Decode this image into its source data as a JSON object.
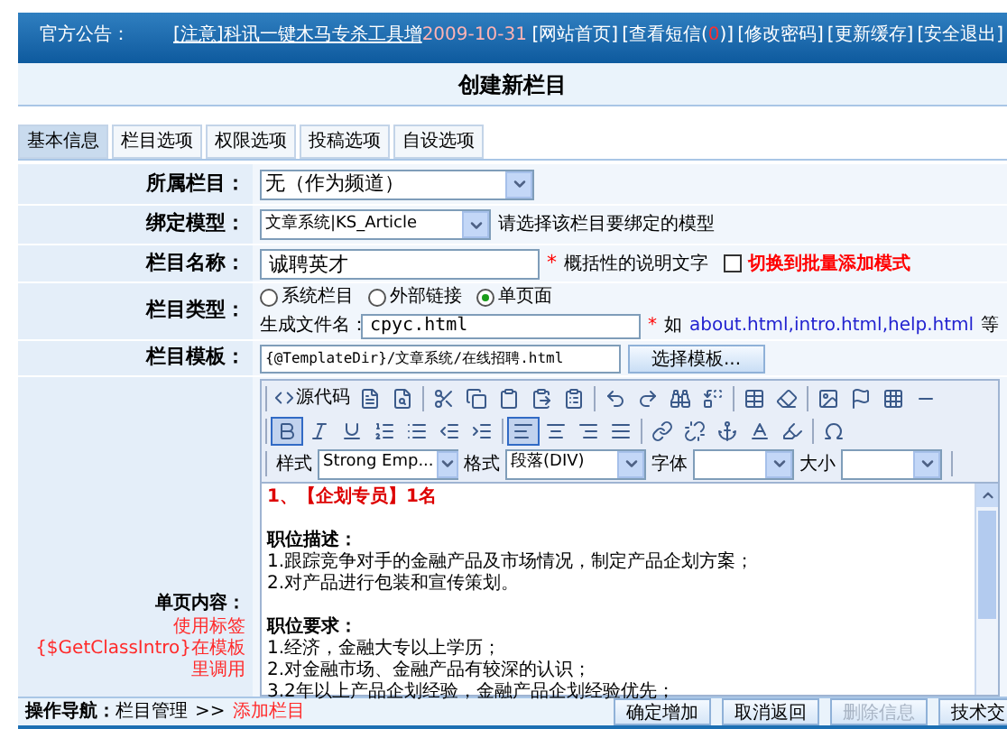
{
  "header": {
    "notice_label": "官方公告：",
    "notice_link": "[注意]科讯一键木马专杀工具增",
    "notice_date": "2009-10-31",
    "links": [
      {
        "text": "[网站首页]"
      },
      {
        "text": "[查看短信(",
        "count": "0",
        "after": ")]"
      },
      {
        "text": "[修改密码]"
      },
      {
        "text": "[更新缓存]"
      },
      {
        "text": "[安全退出]"
      }
    ]
  },
  "page_title": "创建新栏目",
  "tabs": [
    {
      "label": "基本信息",
      "selected": true
    },
    {
      "label": "栏目选项",
      "selected": false
    },
    {
      "label": "权限选项",
      "selected": false
    },
    {
      "label": "投稿选项",
      "selected": false
    },
    {
      "label": "自设选项",
      "selected": false
    }
  ],
  "form": {
    "parent": {
      "label": "所属栏目：",
      "value": "无（作为频道）"
    },
    "model": {
      "label": "绑定模型：",
      "value": "文章系统|KS_Article",
      "hint": "请选择该栏目要绑定的模型"
    },
    "name": {
      "label": "栏目名称：",
      "value": "诚聘英才",
      "required": "*",
      "hint": "概括性的说明文字",
      "batch_label": "切换到批量添加模式",
      "batch_checked": false
    },
    "type": {
      "label": "栏目类型：",
      "options": [
        {
          "label": "系统栏目",
          "selected": false
        },
        {
          "label": "外部链接",
          "selected": false
        },
        {
          "label": "单页面",
          "selected": true
        }
      ],
      "file_label": "生成文件名：",
      "file_value": "cpyc.html",
      "required": "*",
      "example_prefix": "如",
      "example_files": "about.html,intro.html,help.html",
      "example_suffix": "等"
    },
    "template": {
      "label": "栏目模板：",
      "value": "{@TemplateDir}/文章系统/在线招聘.html",
      "button": "选择模板..."
    },
    "content": {
      "label": "单页内容：",
      "note": "使用标签{$GetClassIntro}在模板里调用"
    }
  },
  "editor": {
    "source_label": "源代码",
    "dropdowns": [
      {
        "label": "样式",
        "value": "Strong Emp..."
      },
      {
        "label": "格式",
        "value": "段落(DIV)"
      },
      {
        "label": "字体"
      },
      {
        "label": "大小"
      }
    ],
    "bold_active": true,
    "align_left_active": true,
    "lines": [
      {
        "kind": "title",
        "text": "1、【企划专员】1名"
      },
      {
        "kind": "blank"
      },
      {
        "kind": "heading",
        "text": "职位描述："
      },
      {
        "kind": "text",
        "text": "1.跟踪竞争对手的金融产品及市场情况，制定产品企划方案；"
      },
      {
        "kind": "text",
        "text": "2.对产品进行包装和宣传策划。"
      },
      {
        "kind": "blank"
      },
      {
        "kind": "heading",
        "text": "职位要求："
      },
      {
        "kind": "text",
        "text": "1.经济，金融大专以上学历；"
      },
      {
        "kind": "text",
        "text": "2.对金融市场、金融产品有较深的认识；"
      },
      {
        "kind": "text",
        "text": "3.2年以上产品企划经验，金融产品企划经验优先；"
      }
    ]
  },
  "footer": {
    "nav_label": "操作导航：",
    "crumb": "栏目管理",
    "sep": ">>",
    "current": "添加栏目",
    "buttons": [
      {
        "label": "确定增加",
        "disabled": false
      },
      {
        "label": "取消返回",
        "disabled": false
      },
      {
        "label": "删除信息",
        "disabled": true
      },
      {
        "label": "技术交",
        "disabled": false
      }
    ]
  }
}
